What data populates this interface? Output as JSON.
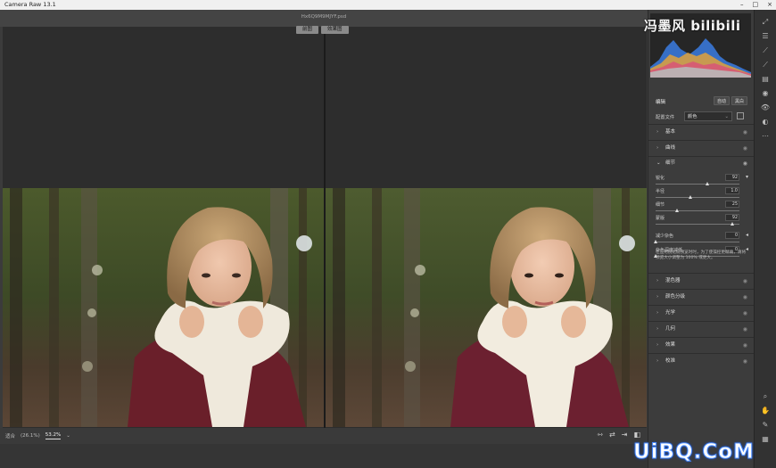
{
  "app": {
    "title": "Camera Raw 13.1"
  },
  "file": {
    "name": "Hx6Q9M9MJYF.psd"
  },
  "view_tabs": [
    "前图",
    "效果图"
  ],
  "statusbar": {
    "zoom_left": "适合",
    "zoom_value": "(26.1%)",
    "zoom_selected": "53.2%",
    "zoom_chevron": "⌄"
  },
  "panel": {
    "edit_label": "编辑",
    "auto_button": "自动",
    "bw_button": "黑白",
    "profile_label": "配置文件",
    "profile_value": "颜色",
    "sections_top": [
      "基本",
      "曲线"
    ],
    "detail": {
      "title": "细节",
      "sliders": [
        {
          "label": "锐化",
          "value": "92",
          "fraction": 0.62
        },
        {
          "label": "半径",
          "value": "1.0",
          "fraction": 0.42
        },
        {
          "label": "细节",
          "value": "25",
          "fraction": 0.25
        },
        {
          "label": "蒙版",
          "value": "92",
          "fraction": 0.92
        },
        {
          "label": "减少杂色",
          "value": "0",
          "fraction": 0.0
        },
        {
          "label": "杂色深度减低",
          "value": "0",
          "fraction": 0.0
        }
      ],
      "hint": "在应用锐化前预览时时，为了使操控更精确，请将预览大小调整为 100% 或更大。"
    },
    "sections_bottom": [
      "混色器",
      "颜色分级",
      "光学",
      "几何",
      "效果",
      "校准"
    ]
  },
  "colors": {
    "accent": "#4a8bff",
    "panel_bg": "#3c3c3c",
    "canvas_bg": "#2d2d2d"
  },
  "watermarks": {
    "top": "冯墨风 bilibili",
    "bottom": "UiBQ.CoM"
  }
}
